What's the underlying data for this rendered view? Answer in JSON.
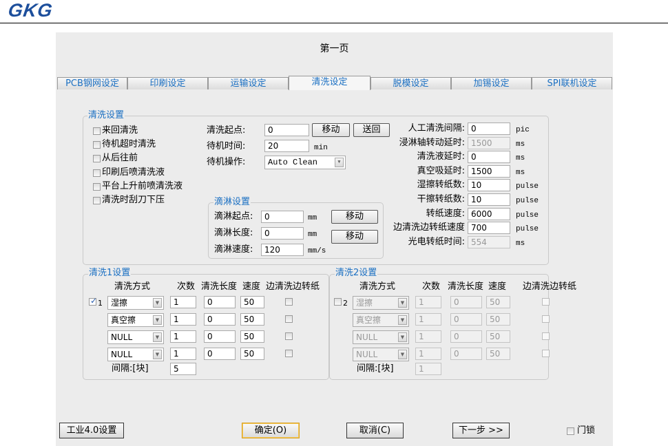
{
  "logo": "GKG",
  "page_title": "第一页",
  "tabs": [
    "PCB钢网设定",
    "印刷设定",
    "运输设定",
    "清洗设定",
    "脱模设定",
    "加锡设定",
    "SPI联机设定"
  ],
  "clean_settings": {
    "label": "清洗设置",
    "checkboxes": [
      "来回清洗",
      "待机超时清洗",
      "从后往前",
      "印刷后喷清洗液",
      "平台上升前喷清洗液",
      "清洗时刮刀下压"
    ],
    "start_label": "清洗起点:",
    "start_value": "0",
    "move_label": "移动",
    "return_label": "送回",
    "standby_time_label": "待机时间:",
    "standby_time_value": "20",
    "standby_time_unit": "min",
    "standby_op_label": "待机操作:",
    "standby_op_value": "Auto Clean"
  },
  "drip": {
    "label": "滴淋设置",
    "rows": [
      {
        "label": "滴淋起点:",
        "value": "0",
        "unit": "mm"
      },
      {
        "label": "滴淋长度:",
        "value": "0",
        "unit": "mm"
      },
      {
        "label": "滴淋速度:",
        "value": "120",
        "unit": "mm/s"
      }
    ],
    "move1": "移动",
    "move2": "移动"
  },
  "params": [
    {
      "label": "人工清洗间隔:",
      "value": "0",
      "unit": "pic",
      "disabled": false
    },
    {
      "label": "浸淋轴转动延时:",
      "value": "1500",
      "unit": "ms",
      "disabled": true
    },
    {
      "label": "清洗液延时:",
      "value": "0",
      "unit": "ms",
      "disabled": false
    },
    {
      "label": "真空吸延时:",
      "value": "1500",
      "unit": "ms",
      "disabled": false
    },
    {
      "label": "湿擦转纸数:",
      "value": "10",
      "unit": "pulse",
      "disabled": false
    },
    {
      "label": "干擦转纸数:",
      "value": "10",
      "unit": "pulse",
      "disabled": false
    },
    {
      "label": "转纸速度:",
      "value": "6000",
      "unit": "pulse",
      "disabled": false
    },
    {
      "label": "边清洗边转纸速度",
      "value": "700",
      "unit": "pulse",
      "disabled": false
    },
    {
      "label": "光电转纸时间:",
      "value": "554",
      "unit": "ms",
      "disabled": true
    }
  ],
  "clean1": {
    "label": "清洗1设置",
    "index": "1",
    "checked": true,
    "headers": [
      "清洗方式",
      "次数",
      "清洗长度",
      "速度",
      "边清洗边转纸"
    ],
    "rows": [
      {
        "mode": "湿擦",
        "count": "1",
        "length": "0",
        "speed": "50"
      },
      {
        "mode": "真空擦",
        "count": "1",
        "length": "0",
        "speed": "50"
      },
      {
        "mode": "NULL",
        "count": "1",
        "length": "0",
        "speed": "50"
      },
      {
        "mode": "NULL",
        "count": "1",
        "length": "0",
        "speed": "50"
      }
    ],
    "interval_label": "间隔:[块]",
    "interval_value": "5"
  },
  "clean2": {
    "label": "清洗2设置",
    "index": "2",
    "checked": false,
    "headers": [
      "清洗方式",
      "次数",
      "清洗长度",
      "速度",
      "边清洗边转纸"
    ],
    "rows": [
      {
        "mode": "湿擦",
        "count": "1",
        "length": "0",
        "speed": "50"
      },
      {
        "mode": "真空擦",
        "count": "1",
        "length": "0",
        "speed": "50"
      },
      {
        "mode": "NULL",
        "count": "1",
        "length": "0",
        "speed": "50"
      },
      {
        "mode": "NULL",
        "count": "1",
        "length": "0",
        "speed": "50"
      }
    ],
    "interval_label": "间隔:[块]",
    "interval_value": "1"
  },
  "footer": {
    "industry": "工业4.0设置",
    "ok": "确定(O)",
    "cancel": "取消(C)",
    "next": "下一步 >>",
    "door_lock": "门锁"
  }
}
